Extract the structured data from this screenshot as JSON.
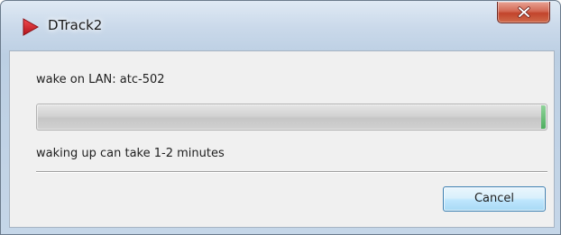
{
  "window": {
    "title": "DTrack2",
    "app_icon": "dtrack-play-icon",
    "close_icon": "close-icon"
  },
  "dialog": {
    "status_text": "wake on LAN: atc-502",
    "progress": {
      "percent": 100
    },
    "hint_text": "waking up can take 1-2 minutes",
    "cancel_label": "Cancel"
  },
  "colors": {
    "app_icon": "#d9282f",
    "close_button": "#c8503a",
    "progress_tip": "#4fae5f",
    "button_border": "#3c7fb1"
  }
}
